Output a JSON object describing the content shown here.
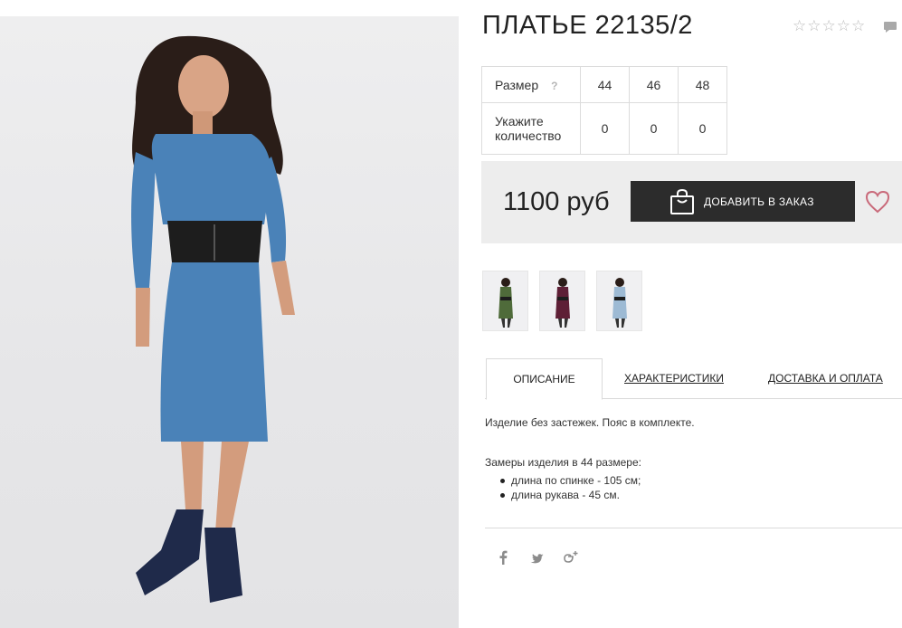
{
  "product": {
    "title": "ПЛАТЬЕ 22135/2",
    "rating": {
      "value": 0,
      "max": 5,
      "empty_star": "☆"
    }
  },
  "size_table": {
    "size_label": "Размер",
    "help_mark": "?",
    "qty_label_line1": "Укажите",
    "qty_label_line2": "количество",
    "sizes": [
      "44",
      "46",
      "48"
    ],
    "quantities": [
      "0",
      "0",
      "0"
    ]
  },
  "purchase": {
    "price": "1100 руб",
    "add_button_label": "ДОБАВИТЬ В ЗАКАЗ",
    "favorite_icon": "heart-icon",
    "bag_icon": "shopping-bag-icon"
  },
  "thumbnails": [
    {
      "color": "#4f6b3a",
      "name": "green"
    },
    {
      "color": "#5e1f36",
      "name": "burgundy"
    },
    {
      "color": "#9dbad4",
      "name": "light-blue"
    }
  ],
  "tabs": {
    "description": "ОПИСАНИЕ",
    "characteristics": "ХАРАКТЕРИСТИКИ",
    "delivery": "ДОСТАВКА И ОПЛАТА"
  },
  "description": {
    "text": "Изделие без застежек. Пояс в комплекте.",
    "measure_title": "Замеры изделия в 44 размере:",
    "measures": [
      "длина по спинке - 105 см;",
      "длина рукава - 45 см."
    ]
  },
  "social": {
    "facebook": "f",
    "twitter": "twitter-icon",
    "google_plus": "g+"
  },
  "colors": {
    "dress": "#4a82b8",
    "button": "#2c2c2c",
    "panel": "#ededed",
    "heart": "#c96a7a"
  }
}
